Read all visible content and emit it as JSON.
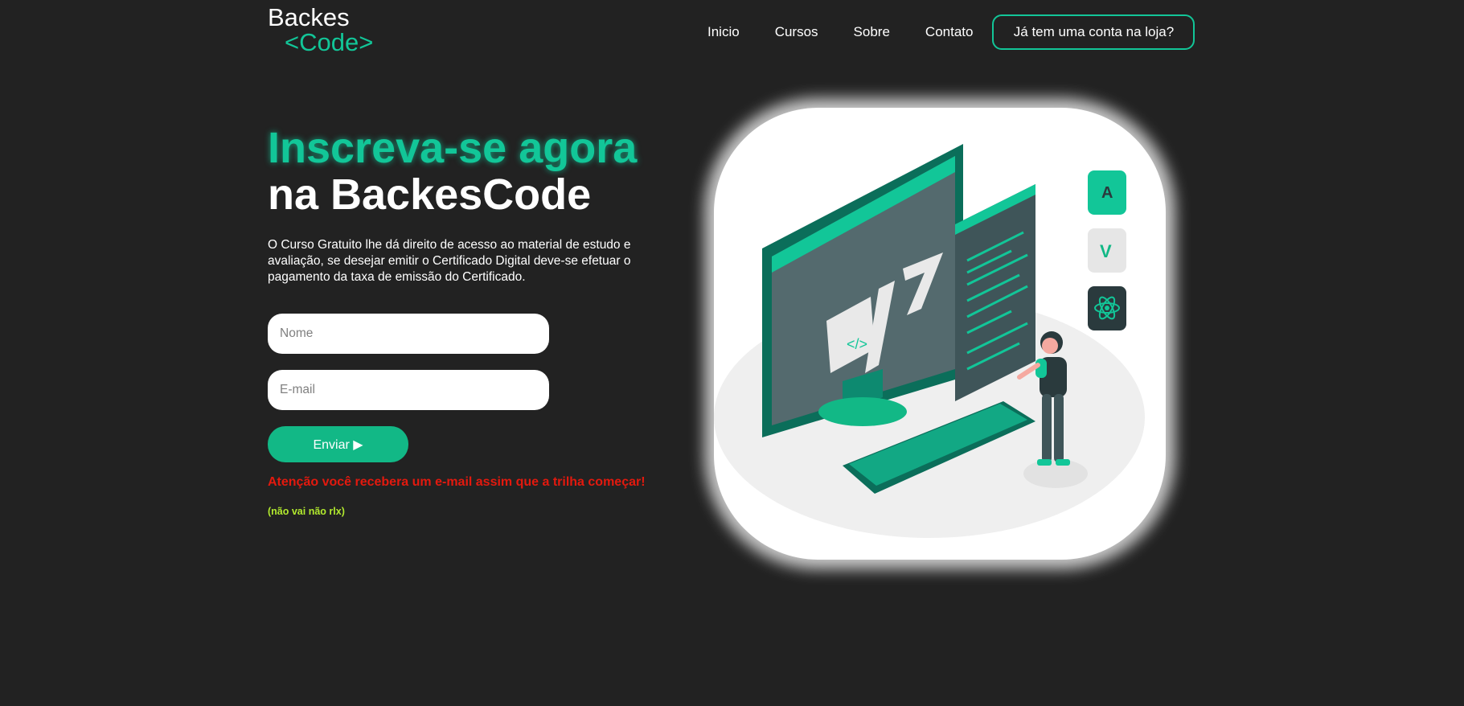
{
  "header": {
    "logo_line1": "Backes",
    "logo_line2": "<Code>",
    "nav": [
      "Inicio",
      "Cursos",
      "Sobre",
      "Contato"
    ],
    "account_button": "Já tem uma conta na loja?"
  },
  "hero": {
    "title_line1": "Inscreva-se agora",
    "title_line2": "na BackesCode",
    "description": "O Curso Gratuito lhe dá direito de acesso ao material de estudo e avaliação, se desejar emitir o Certificado Digital deve-se efetuar o pagamento da taxa de emissão do Certificado."
  },
  "form": {
    "name_placeholder": "Nome",
    "email_placeholder": "E-mail",
    "submit_label": "Enviar ▶",
    "warning": "Atenção você recebera um e-mail assim que a trilha começar!",
    "joke": "(não vai não rlx)"
  },
  "illustration": {
    "code_symbol": "</>",
    "badges": [
      "A",
      "V"
    ]
  },
  "colors": {
    "background": "#222222",
    "accent": "#12c698",
    "button": "#12b886",
    "warning": "#e3190e",
    "joke": "#b2ea2e"
  }
}
